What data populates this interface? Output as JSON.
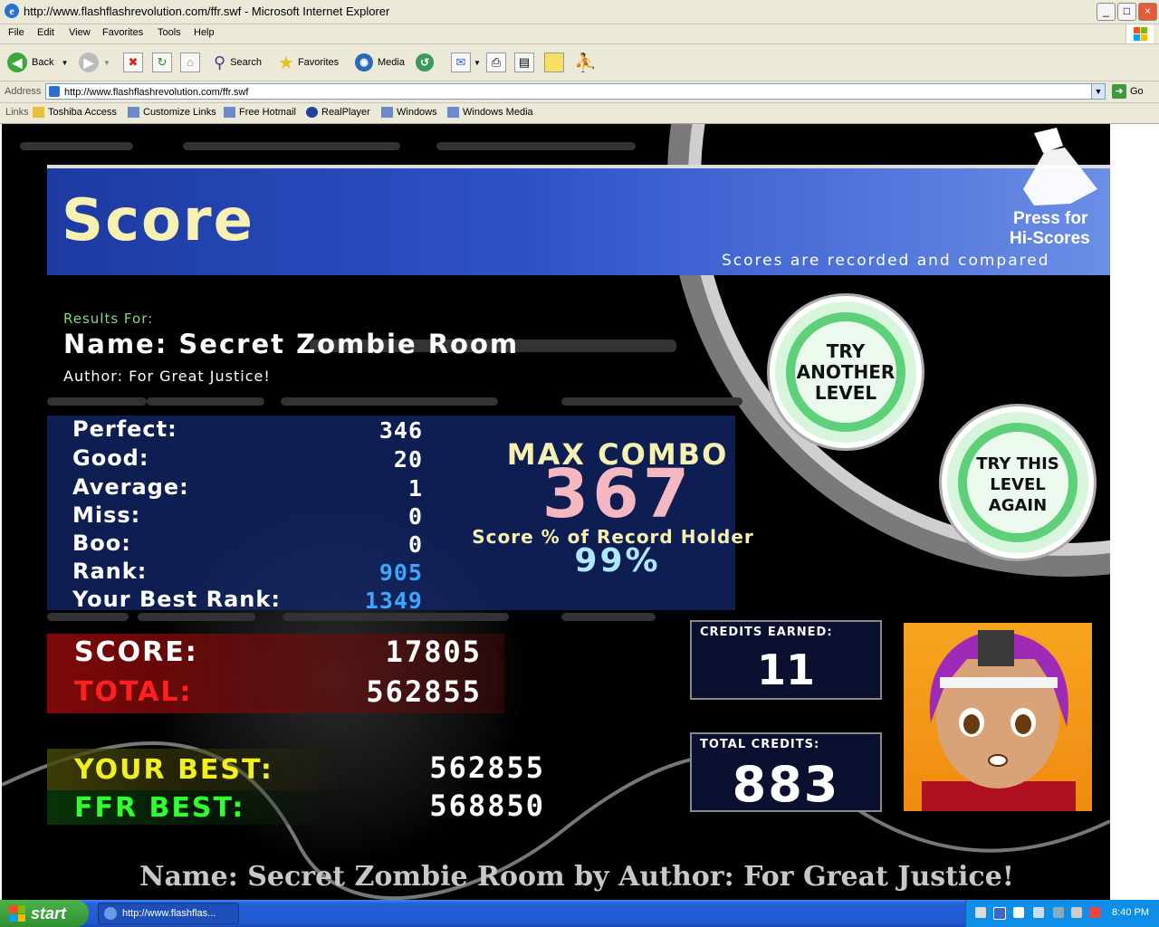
{
  "window": {
    "title": "http://www.flashflashrevolution.com/ffr.swf - Microsoft Internet Explorer",
    "min": "_",
    "max": "□",
    "close": "×"
  },
  "menu": [
    "File",
    "Edit",
    "View",
    "Favorites",
    "Tools",
    "Help"
  ],
  "toolbar": {
    "back": "Back",
    "search": "Search",
    "favorites": "Favorites",
    "media": "Media"
  },
  "address": {
    "label": "Address",
    "url": "http://www.flashflashrevolution.com/ffr.swf",
    "go": "Go"
  },
  "links": {
    "label": "Links",
    "items": [
      "Toshiba Access",
      "Customize Links",
      "Free Hotmail",
      "RealPlayer",
      "Windows",
      "Windows Media"
    ]
  },
  "game": {
    "title": "Score",
    "hiscore_press": "Press for",
    "hiscore_label": "Hi-Scores",
    "recorded": "Scores are recorded and compared",
    "results_for": "Results For:",
    "song_name": "Name: Secret Zombie Room",
    "song_author": "Author: For Great Justice!",
    "stats": [
      {
        "label": "Perfect:",
        "value": "346"
      },
      {
        "label": "Good:",
        "value": "20"
      },
      {
        "label": "Average:",
        "value": "1"
      },
      {
        "label": "Miss:",
        "value": "0"
      },
      {
        "label": "Boo:",
        "value": "0"
      },
      {
        "label": "Rank:",
        "value": "905"
      },
      {
        "label": "Your Best Rank:",
        "value": "1349"
      }
    ],
    "max_combo_label": "MAX COMBO",
    "max_combo": "367",
    "record_label": "Score % of Record Holder",
    "record_pct": "99%",
    "try_another": [
      "TRY",
      "ANOTHER",
      "LEVEL"
    ],
    "try_again": [
      "TRY THIS",
      "LEVEL",
      "AGAIN"
    ],
    "score_label": "SCORE:",
    "score": "17805",
    "total_label": "TOTAL:",
    "total": "562855",
    "your_best_label": "YOUR BEST:",
    "your_best": "562855",
    "ffr_best_label": "FFR BEST:",
    "ffr_best": "568850",
    "credits_earned_label": "CREDITS EARNED:",
    "credits_earned": "11",
    "total_credits_label": "TOTAL CREDITS:",
    "total_credits": "883",
    "footer": "Name:  Secret  Zombie  Room  by  Author:  For  Great  Justice!"
  },
  "taskbar": {
    "start": "start",
    "task": "http://www.flashflas...",
    "clock": "8:40 PM"
  },
  "colors": {
    "banner": "#2d52c8",
    "green_label": "#7ddc7d",
    "rank_blue": "#3aa6ff",
    "combo_pink": "#f5b8c0",
    "pct_cyan": "#aee8ff",
    "total_red": "#ff2020",
    "yourbest_yellow": "#f0f020",
    "ffrbest_green": "#30ff30"
  }
}
